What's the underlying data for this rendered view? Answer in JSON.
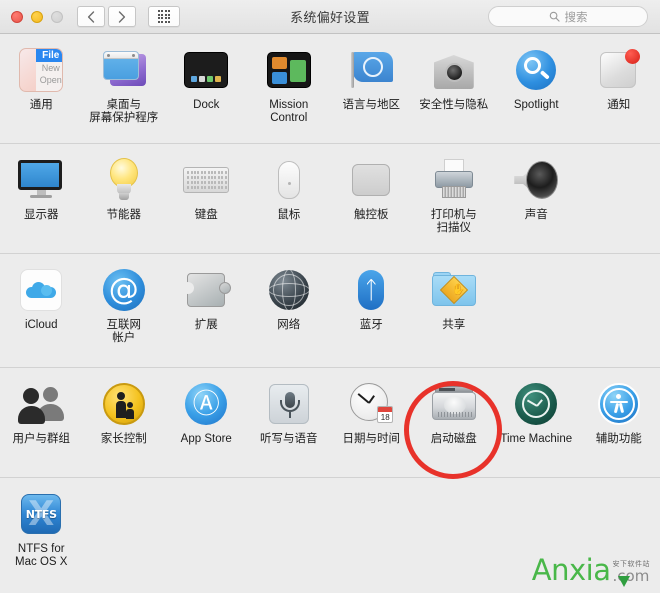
{
  "window": {
    "title": "系统偏好设置",
    "traffic_lights": [
      "close",
      "minimize",
      "zoom"
    ],
    "nav": {
      "back_label": "‹",
      "forward_label": "›",
      "grid_label": "show-all"
    },
    "search": {
      "placeholder": "搜索",
      "value": "",
      "icon": "search-icon"
    }
  },
  "colors": {
    "window_bg": "#ececec",
    "titlebar_bg": "#e6e6e6",
    "separator": "#d2d2d2",
    "highlight_ring": "#e8322a",
    "badge_red": "#d61f16",
    "accent_blue": "#2e8ddb",
    "watermark_green": "#49b749"
  },
  "rows": [
    {
      "id": "row-personal",
      "items": [
        {
          "name": "general",
          "label": "通用",
          "icon": "general-icon"
        },
        {
          "name": "desktop",
          "label": "桌面与\n屏幕保护程序",
          "icon": "desktop-screensaver-icon"
        },
        {
          "name": "dock",
          "label": "Dock",
          "icon": "dock-icon"
        },
        {
          "name": "mission",
          "label": "Mission\nControl",
          "icon": "mission-control-icon"
        },
        {
          "name": "language",
          "label": "语言与地区",
          "icon": "language-region-flag-icon"
        },
        {
          "name": "security",
          "label": "安全性与隐私",
          "icon": "security-privacy-icon"
        },
        {
          "name": "spotlight",
          "label": "Spotlight",
          "icon": "spotlight-icon"
        },
        {
          "name": "notifications",
          "label": "通知",
          "icon": "notifications-icon",
          "badge": true
        }
      ]
    },
    {
      "id": "row-hardware",
      "items": [
        {
          "name": "displays",
          "label": "显示器",
          "icon": "display-icon"
        },
        {
          "name": "energy",
          "label": "节能器",
          "icon": "energy-saver-bulb-icon"
        },
        {
          "name": "keyboard",
          "label": "键盘",
          "icon": "keyboard-icon"
        },
        {
          "name": "mouse",
          "label": "鼠标",
          "icon": "mouse-icon"
        },
        {
          "name": "trackpad",
          "label": "触控板",
          "icon": "trackpad-icon"
        },
        {
          "name": "printers",
          "label": "打印机与\n扫描仪",
          "icon": "printer-scanner-icon"
        },
        {
          "name": "sound",
          "label": "声音",
          "icon": "sound-speaker-icon"
        }
      ]
    },
    {
      "id": "row-internet",
      "items": [
        {
          "name": "icloud",
          "label": "iCloud",
          "icon": "icloud-icon"
        },
        {
          "name": "internet-accounts",
          "label": "互联网\n帐户",
          "icon": "at-sign-icon"
        },
        {
          "name": "extensions",
          "label": "扩展",
          "icon": "puzzle-piece-icon"
        },
        {
          "name": "network",
          "label": "网络",
          "icon": "globe-network-icon"
        },
        {
          "name": "bluetooth",
          "label": "蓝牙",
          "icon": "bluetooth-icon"
        },
        {
          "name": "sharing",
          "label": "共享",
          "icon": "sharing-folder-icon"
        }
      ]
    },
    {
      "id": "row-system",
      "items": [
        {
          "name": "users",
          "label": "用户与群组",
          "icon": "users-groups-icon"
        },
        {
          "name": "parental",
          "label": "家长控制",
          "icon": "parental-controls-icon"
        },
        {
          "name": "appstore",
          "label": "App Store",
          "icon": "app-store-icon"
        },
        {
          "name": "dictation",
          "label": "听写与语音",
          "icon": "dictation-microphone-icon"
        },
        {
          "name": "datetime",
          "label": "日期与时间",
          "icon": "date-time-clock-icon",
          "calendar_day": "18"
        },
        {
          "name": "startup-disk",
          "label": "启动磁盘",
          "icon": "startup-disk-icon",
          "highlighted": true
        },
        {
          "name": "time-machine",
          "label": "Time Machine",
          "icon": "time-machine-icon"
        },
        {
          "name": "accessibility",
          "label": "辅助功能",
          "icon": "accessibility-icon"
        }
      ]
    },
    {
      "id": "row-other",
      "items": [
        {
          "name": "ntfs",
          "label": "NTFS for\nMac OS X",
          "icon": "ntfs-icon",
          "icon_text": "NTFS"
        }
      ]
    }
  ],
  "annotation": {
    "type": "red-circle-highlight",
    "target": "启动磁盘"
  },
  "watermark": {
    "main": "Anxia",
    "domain": ".com",
    "subtitle": "安下软件站"
  }
}
